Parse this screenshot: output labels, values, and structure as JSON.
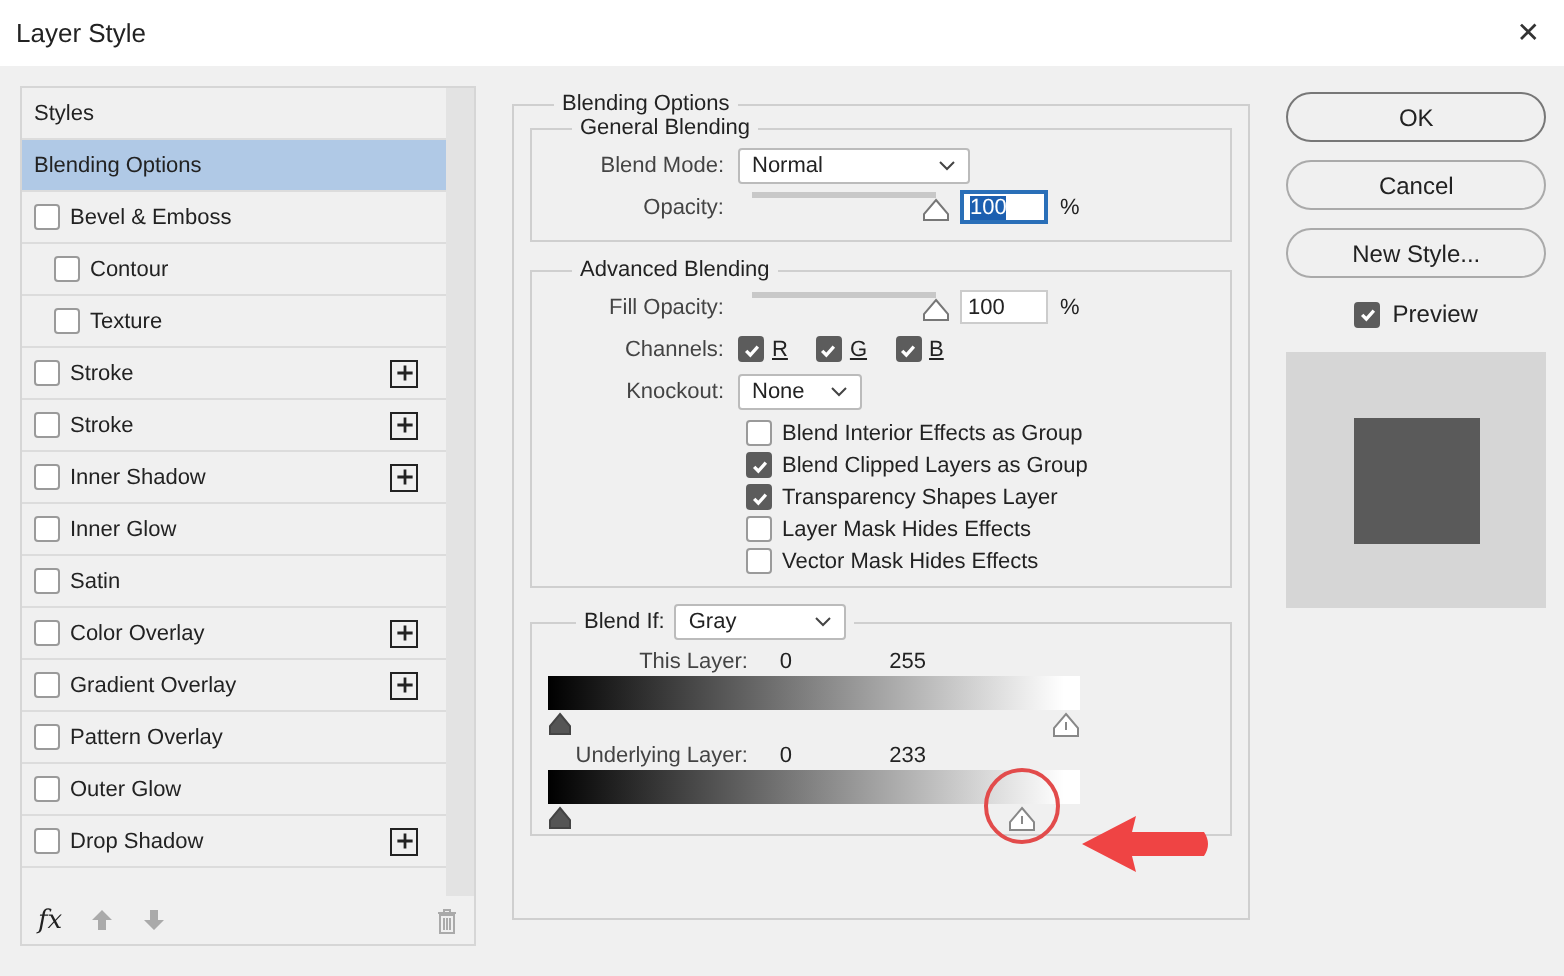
{
  "window": {
    "title": "Layer Style",
    "close": "✕"
  },
  "sidebar": {
    "items": [
      {
        "label": "Styles",
        "kind": "header",
        "selected": false
      },
      {
        "label": "Blending Options",
        "kind": "header",
        "selected": true
      },
      {
        "label": "Bevel & Emboss",
        "kind": "effect",
        "selected": false,
        "checked": false,
        "add_button": false,
        "children": [
          {
            "label": "Contour",
            "kind": "effect",
            "selected": false,
            "checked": false,
            "add_button": false
          },
          {
            "label": "Texture",
            "kind": "effect",
            "selected": false,
            "checked": false,
            "add_button": false
          }
        ]
      },
      {
        "label": "Stroke",
        "kind": "effect",
        "selected": false,
        "checked": false,
        "add_button": true
      },
      {
        "label": "Stroke",
        "kind": "effect",
        "selected": false,
        "checked": false,
        "add_button": true
      },
      {
        "label": "Inner Shadow",
        "kind": "effect",
        "selected": false,
        "checked": false,
        "add_button": true
      },
      {
        "label": "Inner Glow",
        "kind": "effect",
        "selected": false,
        "checked": false,
        "add_button": false
      },
      {
        "label": "Satin",
        "kind": "effect",
        "selected": false,
        "checked": false,
        "add_button": false
      },
      {
        "label": "Color Overlay",
        "kind": "effect",
        "selected": false,
        "checked": false,
        "add_button": true
      },
      {
        "label": "Gradient Overlay",
        "kind": "effect",
        "selected": false,
        "checked": false,
        "add_button": true
      },
      {
        "label": "Pattern Overlay",
        "kind": "effect",
        "selected": false,
        "checked": false,
        "add_button": false
      },
      {
        "label": "Outer Glow",
        "kind": "effect",
        "selected": false,
        "checked": false,
        "add_button": false
      },
      {
        "label": "Drop Shadow",
        "kind": "effect",
        "selected": false,
        "checked": false,
        "add_button": true
      }
    ],
    "footer": {
      "fx": "fx"
    }
  },
  "blending_options": {
    "title": "Blending Options",
    "general_blending": {
      "title": "General Blending",
      "blend_mode": {
        "label": "Blend Mode:",
        "value": "Normal"
      },
      "opacity": {
        "label": "Opacity:",
        "level": 1,
        "value": "100",
        "unit": "%",
        "highlighted": true
      }
    },
    "advanced_blending": {
      "title": "Advanced Blending",
      "fill_opacity": {
        "label": "Fill Opacity:",
        "level": 1,
        "value": "100",
        "unit": "%",
        "highlighted": false
      },
      "channels": {
        "label": "Channels:",
        "items": [
          {
            "label": "R",
            "checked": true
          },
          {
            "label": "G",
            "checked": true
          },
          {
            "label": "B",
            "checked": true
          }
        ]
      },
      "knockout": {
        "label": "Knockout:",
        "value": "None"
      },
      "options": [
        {
          "label": "Blend Interior Effects as Group",
          "checked": false
        },
        {
          "label": "Blend Clipped Layers as Group",
          "checked": true
        },
        {
          "label": "Transparency Shapes Layer",
          "checked": true
        },
        {
          "label": "Layer Mask Hides Effects",
          "checked": false
        },
        {
          "label": "Vector Mask Hides Effects",
          "checked": false
        }
      ]
    },
    "blend_if": {
      "label": "Blend If:",
      "value": "Gray",
      "sliders": [
        {
          "label": "This Layer:",
          "low": "0",
          "high": "255",
          "level": 1
        },
        {
          "label": "Underlying Layer:",
          "low": "0",
          "high": "233",
          "level": 0.914
        }
      ]
    }
  },
  "buttons": [
    {
      "label": "OK",
      "default": true
    },
    {
      "label": "Cancel",
      "default": false
    },
    {
      "label": "New Style...",
      "default": false
    }
  ],
  "preview": {
    "label": "Preview",
    "checked": true
  },
  "annotation": {
    "kind": "circle-arrow"
  }
}
